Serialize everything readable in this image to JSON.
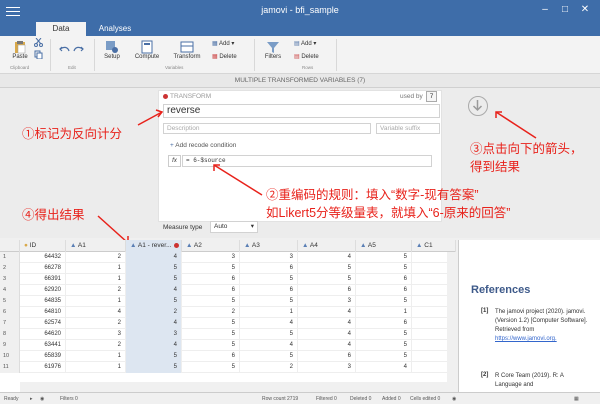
{
  "window": {
    "title": "jamovi - bfi_sample"
  },
  "tabs": [
    "Data",
    "Analyses"
  ],
  "ribbon": {
    "paste": "Paste",
    "clipboard": "Clipboard",
    "edit": "Edit",
    "setup": "Setup",
    "compute": "Compute",
    "transform": "Transform",
    "add": "Add",
    "delete": "Delete",
    "variables": "Variables",
    "filters": "Filters",
    "rows_add": "Add",
    "rows_delete": "Delete",
    "rows": "Rows"
  },
  "editor": {
    "header": "MULTIPLE TRANSFORMED VARIABLES (7)",
    "transform_label": "TRANSFORM",
    "used_by": "used by",
    "used_by_count": "7",
    "name": "reverse",
    "description_ph": "Description",
    "suffix_ph": "Variable suffix",
    "add_condition": "Add recode condition",
    "formula": "= 6-$source",
    "fx": "fx",
    "measure_label": "Measure type",
    "measure_value": "Auto"
  },
  "annotations": {
    "a1": "①标记为反向计分",
    "a2_line1": "②重编码的规则：填入“数字-现有答案”",
    "a2_line2": "如Likert5分等级量表，就填入“6-原来的回答”",
    "a3_line1": "③点击向下的箭头，",
    "a3_line2": "得到结果",
    "a4": "④得出结果"
  },
  "grid": {
    "columns": [
      "ID",
      "A1",
      "A1 - rever...",
      "A2",
      "A3",
      "A4",
      "A5",
      "C1"
    ],
    "rows": [
      {
        "n": "1",
        "v": [
          "64432",
          "2",
          "4",
          "3",
          "3",
          "4",
          "5",
          "4"
        ]
      },
      {
        "n": "2",
        "v": [
          "66278",
          "1",
          "5",
          "5",
          "6",
          "5",
          "5",
          "4"
        ]
      },
      {
        "n": "3",
        "v": [
          "66391",
          "1",
          "5",
          "6",
          "5",
          "5",
          "6",
          "6"
        ]
      },
      {
        "n": "4",
        "v": [
          "62920",
          "2",
          "4",
          "6",
          "6",
          "6",
          "6",
          "6"
        ]
      },
      {
        "n": "5",
        "v": [
          "64835",
          "1",
          "5",
          "5",
          "5",
          "3",
          "5",
          "4"
        ]
      },
      {
        "n": "6",
        "v": [
          "64810",
          "4",
          "2",
          "2",
          "1",
          "4",
          "1",
          "4"
        ]
      },
      {
        "n": "7",
        "v": [
          "62574",
          "2",
          "4",
          "5",
          "4",
          "4",
          "6",
          "6"
        ]
      },
      {
        "n": "8",
        "v": [
          "64620",
          "3",
          "3",
          "5",
          "5",
          "4",
          "5",
          "4"
        ]
      },
      {
        "n": "9",
        "v": [
          "63441",
          "2",
          "4",
          "5",
          "4",
          "4",
          "5",
          "5"
        ]
      },
      {
        "n": "10",
        "v": [
          "65839",
          "1",
          "5",
          "6",
          "5",
          "6",
          "5",
          "5"
        ]
      },
      {
        "n": "11",
        "v": [
          "61976",
          "1",
          "5",
          "5",
          "2",
          "3",
          "4",
          "4"
        ]
      }
    ]
  },
  "results": {
    "title": "References",
    "ref1_num": "[1]",
    "ref1": "The jamovi project (2020). jamovi. (Version 1.2) [Computer Software]. Retrieved from",
    "ref1_link": "https://www.jamovi.org.",
    "ref2_num": "[2]",
    "ref2": "R Core Team (2019). R: A Language and"
  },
  "status": {
    "ready": "Ready",
    "filters": "Filters 0",
    "row_count": "Row count 2719",
    "filtered": "Filtered 0",
    "deleted": "Deleted 0",
    "added": "Added 0",
    "cells_edited": "Cells edited 0"
  }
}
